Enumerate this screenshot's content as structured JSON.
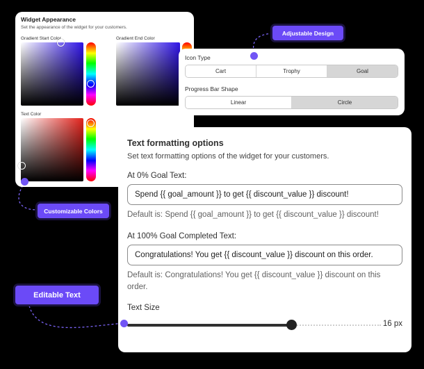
{
  "widget_appearance": {
    "title": "Widget Appearance",
    "subtitle": "Set the appearance of the widget for your customers.",
    "gradient_start_label": "Gradient Start Color",
    "gradient_end_label": "Gradient End Color",
    "text_color_label": "Text Color",
    "colors": {
      "gradient_start": "#3015e8",
      "gradient_end": "#3015e8",
      "text": "#e3231c"
    }
  },
  "icon_settings": {
    "icon_type_label": "Icon Type",
    "icon_options": [
      "Cart",
      "Trophy",
      "Goal"
    ],
    "icon_selected": "Goal",
    "progress_shape_label": "Progress Bar Shape",
    "shape_options": [
      "Linear",
      "Circle"
    ],
    "shape_selected": "Circle"
  },
  "text_formatting": {
    "title": "Text formatting options",
    "subtitle": "Set text formatting options of the widget for your customers.",
    "goal0_label": "At 0% Goal Text:",
    "goal0_value": "Spend {{ goal_amount }} to get {{ discount_value }} discount!",
    "goal0_default": "Default is: Spend {{ goal_amount }} to get {{ discount_value }} discount!",
    "goal100_label": "At 100% Goal Completed Text:",
    "goal100_value": "Congratulations! You get {{ discount_value }} discount on this order.",
    "goal100_default": "Default is: Congratulations! You get {{ discount_value }} discount on this order.",
    "text_size_label": "Text Size",
    "text_size_value": "16 px",
    "text_size_fraction": 0.65
  },
  "tags": {
    "adjustable": "Adjustable Design",
    "customizable": "Customizable Colors",
    "editable": "Editable Text"
  },
  "accent_color": "#6b4af7"
}
